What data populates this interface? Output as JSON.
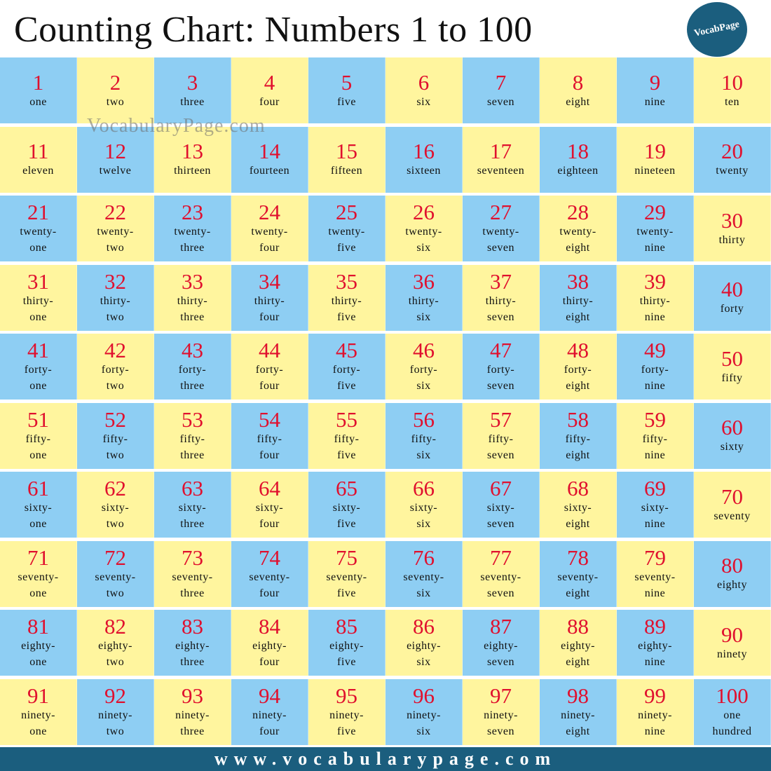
{
  "header": {
    "title": "Counting Chart: Numbers 1 to 100",
    "logo_text": "VocabPage"
  },
  "watermark": "VocabularyPage.com",
  "footer": {
    "url": "www.vocabularypage.com"
  },
  "colors": {
    "blue": "#8ECEF3",
    "yellow": "#FFF59E",
    "number_red": "#E0102E",
    "banner": "#1B5E7E"
  },
  "cells": [
    {
      "n": "1",
      "w": "one"
    },
    {
      "n": "2",
      "w": "two"
    },
    {
      "n": "3",
      "w": "three"
    },
    {
      "n": "4",
      "w": "four"
    },
    {
      "n": "5",
      "w": "five"
    },
    {
      "n": "6",
      "w": "six"
    },
    {
      "n": "7",
      "w": "seven"
    },
    {
      "n": "8",
      "w": "eight"
    },
    {
      "n": "9",
      "w": "nine"
    },
    {
      "n": "10",
      "w": "ten"
    },
    {
      "n": "11",
      "w": "eleven"
    },
    {
      "n": "12",
      "w": "twelve"
    },
    {
      "n": "13",
      "w": "thirteen"
    },
    {
      "n": "14",
      "w": "fourteen"
    },
    {
      "n": "15",
      "w": "fifteen"
    },
    {
      "n": "16",
      "w": "sixteen"
    },
    {
      "n": "17",
      "w": "seventeen"
    },
    {
      "n": "18",
      "w": "eighteen"
    },
    {
      "n": "19",
      "w": "nineteen"
    },
    {
      "n": "20",
      "w": "twenty"
    },
    {
      "n": "21",
      "w": "twenty-\none"
    },
    {
      "n": "22",
      "w": "twenty-\ntwo"
    },
    {
      "n": "23",
      "w": "twenty-\nthree"
    },
    {
      "n": "24",
      "w": "twenty-\nfour"
    },
    {
      "n": "25",
      "w": "twenty-\nfive"
    },
    {
      "n": "26",
      "w": "twenty-\nsix"
    },
    {
      "n": "27",
      "w": "twenty-\nseven"
    },
    {
      "n": "28",
      "w": "twenty-\neight"
    },
    {
      "n": "29",
      "w": "twenty-\nnine"
    },
    {
      "n": "30",
      "w": "thirty"
    },
    {
      "n": "31",
      "w": "thirty-\none"
    },
    {
      "n": "32",
      "w": "thirty-\ntwo"
    },
    {
      "n": "33",
      "w": "thirty-\nthree"
    },
    {
      "n": "34",
      "w": "thirty-\nfour"
    },
    {
      "n": "35",
      "w": "thirty-\nfive"
    },
    {
      "n": "36",
      "w": "thirty-\nsix"
    },
    {
      "n": "37",
      "w": "thirty-\nseven"
    },
    {
      "n": "38",
      "w": "thirty-\neight"
    },
    {
      "n": "39",
      "w": "thirty-\nnine"
    },
    {
      "n": "40",
      "w": "forty"
    },
    {
      "n": "41",
      "w": "forty-\none"
    },
    {
      "n": "42",
      "w": "forty-\ntwo"
    },
    {
      "n": "43",
      "w": "forty-\nthree"
    },
    {
      "n": "44",
      "w": "forty-\nfour"
    },
    {
      "n": "45",
      "w": "forty-\nfive"
    },
    {
      "n": "46",
      "w": "forty-\nsix"
    },
    {
      "n": "47",
      "w": "forty-\nseven"
    },
    {
      "n": "48",
      "w": "forty-\neight"
    },
    {
      "n": "49",
      "w": "forty-\nnine"
    },
    {
      "n": "50",
      "w": "fifty"
    },
    {
      "n": "51",
      "w": "fifty-\none"
    },
    {
      "n": "52",
      "w": "fifty-\ntwo"
    },
    {
      "n": "53",
      "w": "fifty-\nthree"
    },
    {
      "n": "54",
      "w": "fifty-\nfour"
    },
    {
      "n": "55",
      "w": "fifty-\nfive"
    },
    {
      "n": "56",
      "w": "fifty-\nsix"
    },
    {
      "n": "57",
      "w": "fifty-\nseven"
    },
    {
      "n": "58",
      "w": "fifty-\neight"
    },
    {
      "n": "59",
      "w": "fifty-\nnine"
    },
    {
      "n": "60",
      "w": "sixty"
    },
    {
      "n": "61",
      "w": "sixty-\none"
    },
    {
      "n": "62",
      "w": "sixty-\ntwo"
    },
    {
      "n": "63",
      "w": "sixty-\nthree"
    },
    {
      "n": "64",
      "w": "sixty-\nfour"
    },
    {
      "n": "65",
      "w": "sixty-\nfive"
    },
    {
      "n": "66",
      "w": "sixty-\nsix"
    },
    {
      "n": "67",
      "w": "sixty-\nseven"
    },
    {
      "n": "68",
      "w": "sixty-\neight"
    },
    {
      "n": "69",
      "w": "sixty-\nnine"
    },
    {
      "n": "70",
      "w": "seventy"
    },
    {
      "n": "71",
      "w": "seventy-\none"
    },
    {
      "n": "72",
      "w": "seventy-\ntwo"
    },
    {
      "n": "73",
      "w": "seventy-\nthree"
    },
    {
      "n": "74",
      "w": "seventy-\nfour"
    },
    {
      "n": "75",
      "w": "seventy-\nfive"
    },
    {
      "n": "76",
      "w": "seventy-\nsix"
    },
    {
      "n": "77",
      "w": "seventy-\nseven"
    },
    {
      "n": "78",
      "w": "seventy-\neight"
    },
    {
      "n": "79",
      "w": "seventy-\nnine"
    },
    {
      "n": "80",
      "w": "eighty"
    },
    {
      "n": "81",
      "w": "eighty-\none"
    },
    {
      "n": "82",
      "w": "eighty-\ntwo"
    },
    {
      "n": "83",
      "w": "eighty-\nthree"
    },
    {
      "n": "84",
      "w": "eighty-\nfour"
    },
    {
      "n": "85",
      "w": "eighty-\nfive"
    },
    {
      "n": "86",
      "w": "eighty-\nsix"
    },
    {
      "n": "87",
      "w": "eighty-\nseven"
    },
    {
      "n": "88",
      "w": "eighty-\neight"
    },
    {
      "n": "89",
      "w": "eighty-\nnine"
    },
    {
      "n": "90",
      "w": "ninety"
    },
    {
      "n": "91",
      "w": "ninety-\none"
    },
    {
      "n": "92",
      "w": "ninety-\ntwo"
    },
    {
      "n": "93",
      "w": "ninety-\nthree"
    },
    {
      "n": "94",
      "w": "ninety-\nfour"
    },
    {
      "n": "95",
      "w": "ninety-\nfive"
    },
    {
      "n": "96",
      "w": "ninety-\nsix"
    },
    {
      "n": "97",
      "w": "ninety-\nseven"
    },
    {
      "n": "98",
      "w": "ninety-\neight"
    },
    {
      "n": "99",
      "w": "ninety-\nnine"
    },
    {
      "n": "100",
      "w": "one\nhundred"
    }
  ]
}
